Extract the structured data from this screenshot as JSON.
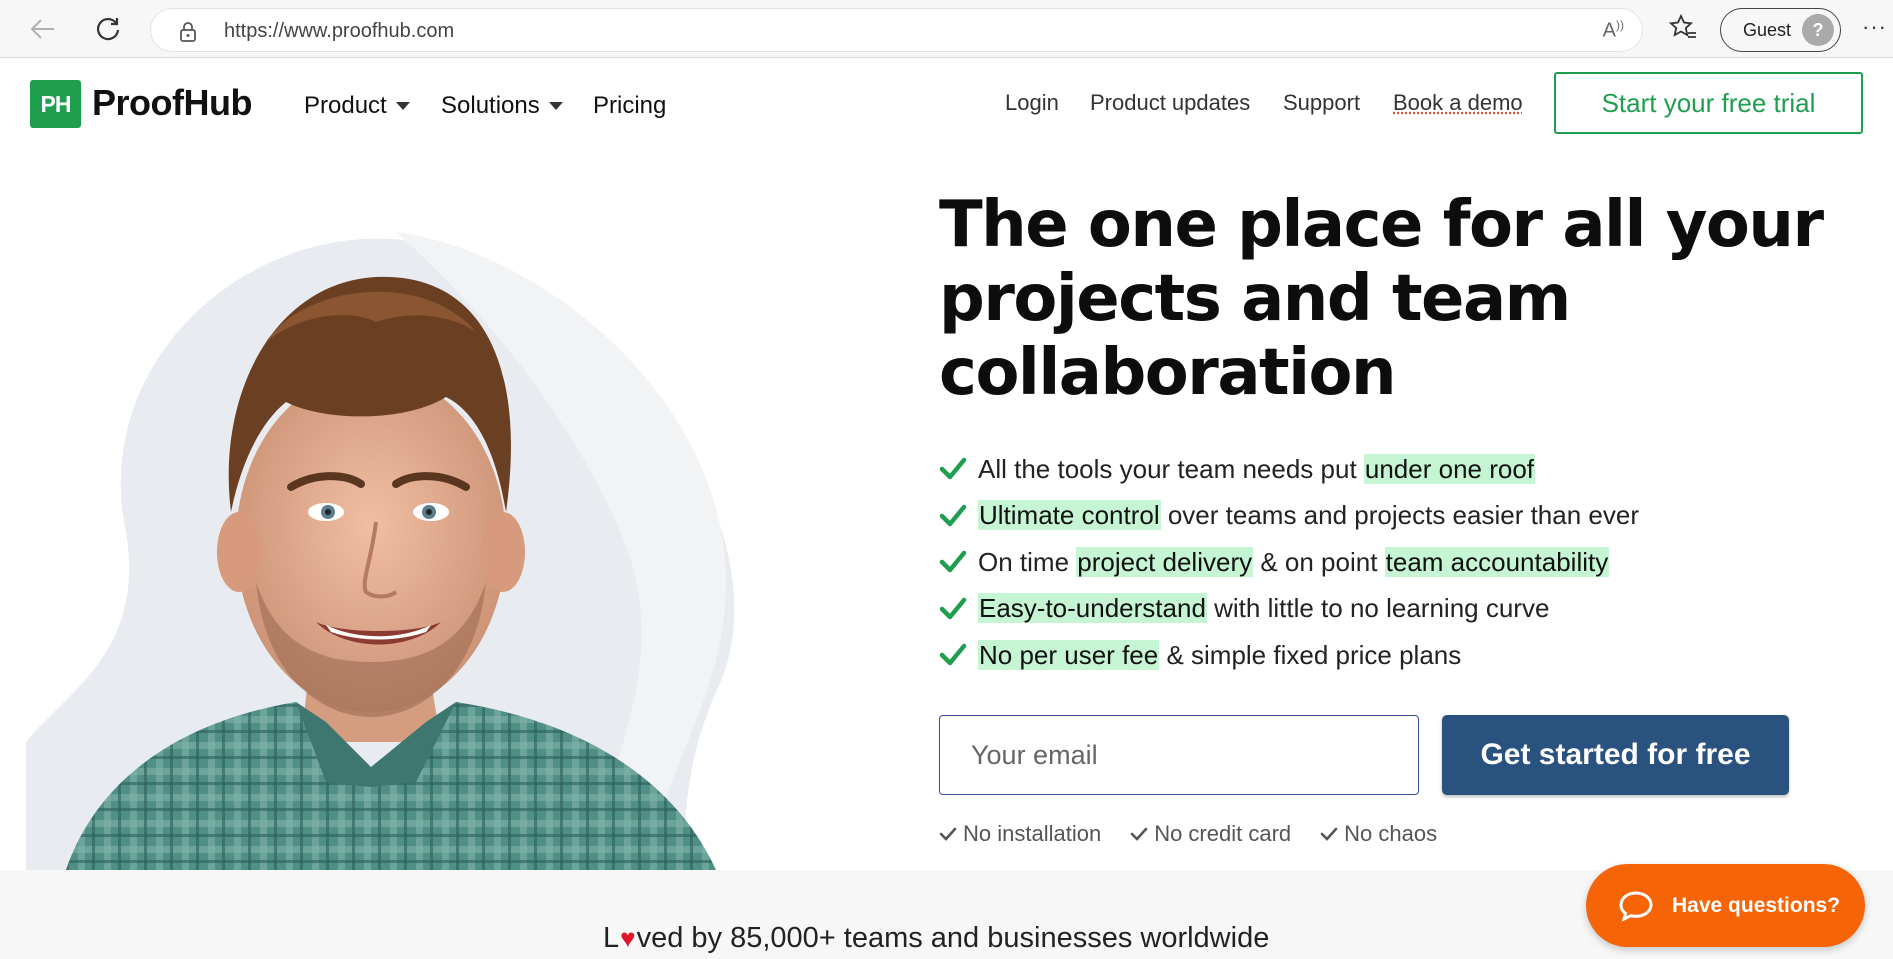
{
  "browser": {
    "url": "https://www.proofhub.com",
    "profile_label": "Guest",
    "back_icon": "back-arrow-icon",
    "refresh_icon": "refresh-icon",
    "more_label": "···"
  },
  "header": {
    "logo_mark": "PH",
    "logo_text": "ProofHub",
    "nav": {
      "product": "Product",
      "solutions": "Solutions",
      "pricing": "Pricing"
    },
    "links": {
      "login": "Login",
      "product_updates": "Product updates",
      "support": "Support",
      "book_demo": "Book a demo"
    },
    "trial_button": "Start your free trial",
    "brand_color": "#1f9e4f"
  },
  "hero": {
    "title": "The one place for all your projects and team collaboration",
    "features": [
      {
        "pre": "All the tools your team needs put ",
        "hl": "under one roof",
        "post": "",
        "hl2": "",
        "post2": ""
      },
      {
        "pre": "",
        "hl": "Ultimate control",
        "post": " over teams and projects easier than ever",
        "hl2": "",
        "post2": ""
      },
      {
        "pre": "On time ",
        "hl": "project delivery",
        "post": " & on point ",
        "hl2": "team accountability",
        "post2": ""
      },
      {
        "pre": "",
        "hl": "Easy-to-understand",
        "post": " with little to no learning curve",
        "hl2": "",
        "post2": ""
      },
      {
        "pre": "",
        "hl": "No per user fee",
        "post": " & simple fixed price plans",
        "hl2": "",
        "post2": ""
      }
    ],
    "email_placeholder": "Your email",
    "cta_button": "Get started for free",
    "cta_color": "#2a527f",
    "mini_checks": [
      "No installation",
      "No credit card",
      "No chaos"
    ]
  },
  "footer_band": {
    "loved_prefix": "L",
    "loved_suffix": "ved by 85,000+ teams and businesses worldwide"
  },
  "chat": {
    "label": "Have questions?",
    "color": "#f56406"
  }
}
